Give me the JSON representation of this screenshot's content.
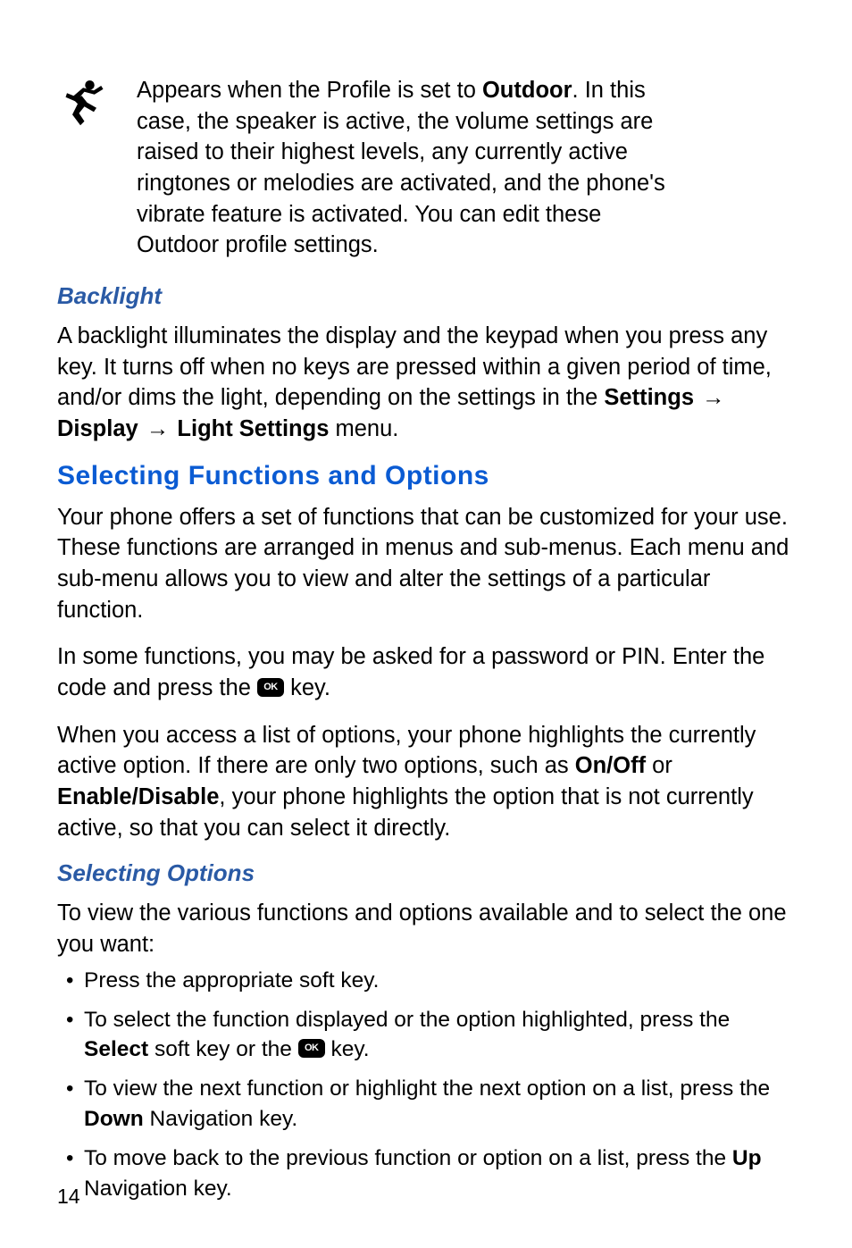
{
  "iconRow": {
    "iconName": "outdoor-running-person-icon",
    "pre": "Appears when the Profile is set to ",
    "boldWord": "Outdoor",
    "post": ". In this case, the speaker is active, the volume settings are raised to their highest levels, any currently active ringtones or melodies are activated, and the phone's vibrate feature is activated. You can edit these Outdoor profile settings."
  },
  "backlight": {
    "heading": "Backlight",
    "text_pre": "A backlight illuminates the display and the keypad when you press any key. It turns off when no keys are pressed within a given period of time, and/or dims the light, depending on the settings in the ",
    "path_settings": "Settings",
    "path_display": "Display",
    "path_light": "Light Settings",
    "text_post": " menu."
  },
  "selecting": {
    "heading": "Selecting Functions and Options",
    "p1": "Your phone offers a set of functions that can be customized for your use. These functions are arranged in menus and sub-menus. Each menu and sub-menu allows you to view and alter the settings of a particular function.",
    "p2_pre": "In some functions, you may be asked for a password or PIN. Enter the code and press the ",
    "p2_post": " key.",
    "p3_pre": "When you access a list of options, your phone highlights the currently active option. If there are only two options, such as ",
    "p3_b1": "On/Off",
    "p3_mid": " or ",
    "p3_b2": "Enable/Disable",
    "p3_post": ", your phone highlights the option that is not currently active, so that you can select it directly."
  },
  "selectingOptions": {
    "heading": "Selecting Options",
    "intro": "To view the various functions and options available and to select the one you want:",
    "bullets": {
      "b1": "Press the appropriate soft key.",
      "b2_pre": "To select the function displayed or the option highlighted, press the ",
      "b2_bold": "Select",
      "b2_mid": " soft key or the ",
      "b2_post": " key.",
      "b3_pre": "To view the next function or highlight the next option on a list, press the ",
      "b3_bold": "Down",
      "b3_post": " Navigation key.",
      "b4_pre": "To move back to the previous function or option on a list, press the ",
      "b4_bold": "Up",
      "b4_post": " Navigation key."
    }
  },
  "okLabel": "OK",
  "arrowGlyph": "→",
  "pageNumber": "14"
}
